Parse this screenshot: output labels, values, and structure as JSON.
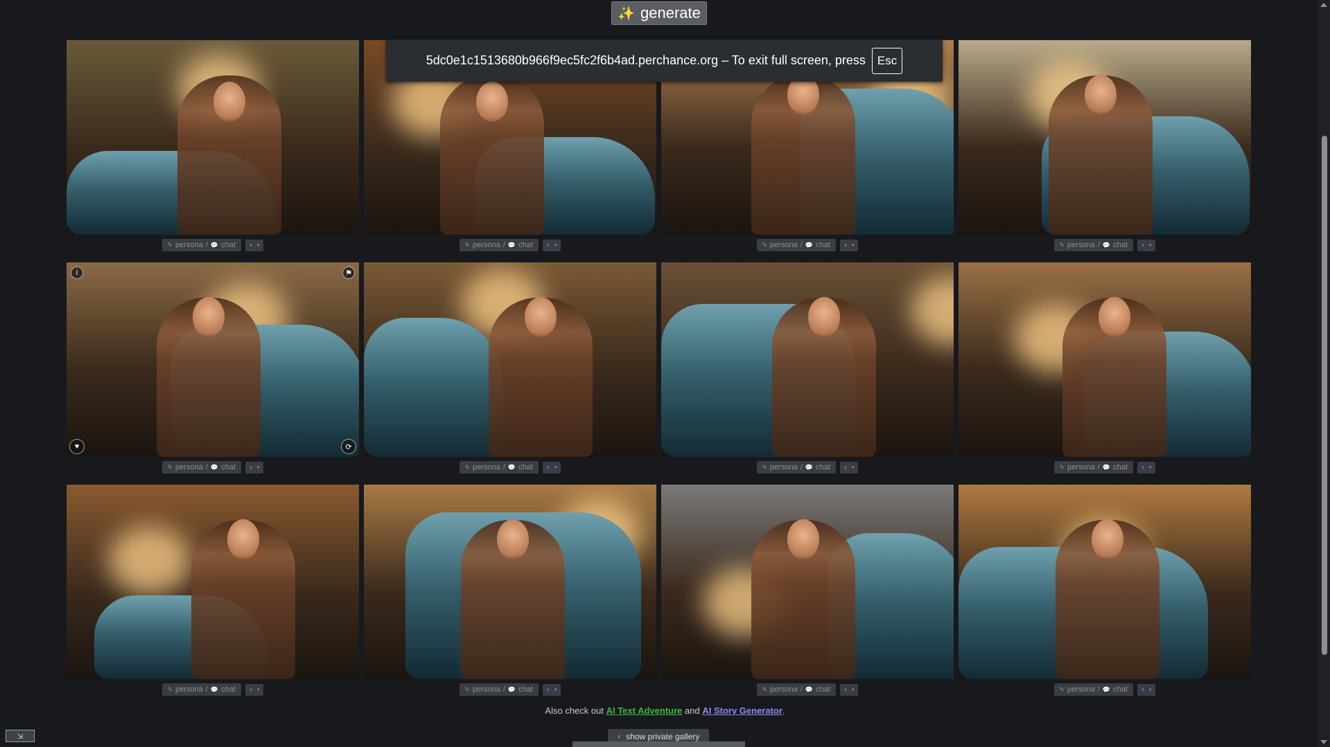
{
  "toolbar": {
    "generate_label": "generate",
    "generate_icon": "sparkles-icon"
  },
  "fullscreen_notice": {
    "text": "5dc0e1c1513680b966f9ec5fc2f6b4ad.perchance.org – To exit full screen, press",
    "key": "Esc"
  },
  "gallery": {
    "items": [
      {
        "persona": "persona",
        "sep": "/",
        "chat": "chat"
      },
      {
        "persona": "persona",
        "sep": "/",
        "chat": "chat"
      },
      {
        "persona": "persona",
        "sep": "/",
        "chat": "chat"
      },
      {
        "persona": "persona",
        "sep": "/",
        "chat": "chat"
      },
      {
        "persona": "persona",
        "sep": "/",
        "chat": "chat"
      },
      {
        "persona": "persona",
        "sep": "/",
        "chat": "chat"
      },
      {
        "persona": "persona",
        "sep": "/",
        "chat": "chat"
      },
      {
        "persona": "persona",
        "sep": "/",
        "chat": "chat"
      },
      {
        "persona": "persona",
        "sep": "/",
        "chat": "chat"
      },
      {
        "persona": "persona",
        "sep": "/",
        "chat": "chat"
      },
      {
        "persona": "persona",
        "sep": "/",
        "chat": "chat"
      },
      {
        "persona": "persona",
        "sep": "/",
        "chat": "chat"
      }
    ]
  },
  "footer": {
    "prefix": "Also check out",
    "link1": "AI Text Adventure",
    "mid": "and",
    "link2": "AI Story Generator",
    "suffix": "."
  },
  "private_gallery": {
    "label": "show private gallery"
  },
  "colors": {
    "background": "#17191c",
    "accent_green": "#3fb83f",
    "accent_blue": "#8c8cf0"
  }
}
